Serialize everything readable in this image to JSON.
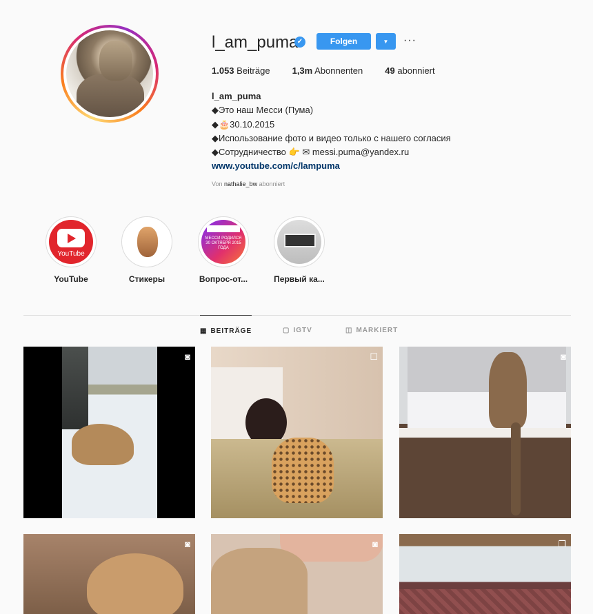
{
  "profile": {
    "username": "l_am_puma",
    "verified_icon": "verified-badge-icon",
    "follow_label": "Folgen",
    "dropdown_glyph": "▼",
    "more_glyph": "···",
    "stats": {
      "posts_count": "1.053",
      "posts_label": " Beiträge",
      "followers_count": "1,3m",
      "followers_label": " Abonnenten",
      "following_count": "49",
      "following_label": " abonniert"
    },
    "bio": {
      "name": "l_am_puma",
      "line1": "◆Это наш Месси (Пума)",
      "line2": "◆🎂30.10.2015",
      "line3": "◆Использование фото и видео только с нашего согласия",
      "line4": "◆Сотрудничество 👉 ✉ messi.puma@yandex.ru",
      "link": "www.youtube.com/c/lampuma"
    },
    "followed_by": {
      "prefix": "Von ",
      "user": "nathalie_bw",
      "suffix": " abonniert"
    }
  },
  "highlights": [
    {
      "label": "YouTube",
      "cover_text": "YouTube"
    },
    {
      "label": "Стикеры"
    },
    {
      "label": "Вопрос-от...",
      "cover_text": "МЕССИ РОДИЛСЯ 30 ОКТЯБРЯ 2015 ГОДА"
    },
    {
      "label": "Первый ка..."
    }
  ],
  "tabs": [
    {
      "label": "BEITRÄGE",
      "icon": "grid-icon",
      "active": true
    },
    {
      "label": "IGTV",
      "icon": "igtv-icon",
      "active": false
    },
    {
      "label": "MARKIERT",
      "icon": "tagged-icon",
      "active": false
    }
  ],
  "posts": [
    {
      "type": "video",
      "badge": "video-icon"
    },
    {
      "type": "photo",
      "badge": "photo-icon"
    },
    {
      "type": "video",
      "badge": "video-icon"
    },
    {
      "type": "video",
      "badge": "video-icon"
    },
    {
      "type": "video",
      "badge": "video-icon"
    },
    {
      "type": "carousel",
      "badge": "carousel-icon"
    }
  ],
  "colors": {
    "accent": "#3897f0",
    "text": "#262626",
    "muted": "#8e8e8e",
    "link": "#003569"
  }
}
